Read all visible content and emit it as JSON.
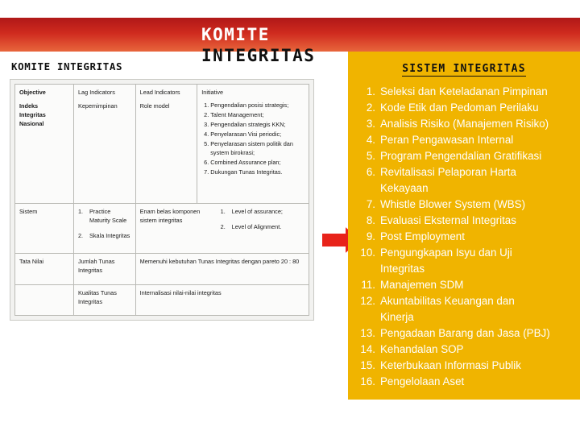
{
  "slide": {
    "left_title": "KOMITE INTEGRITAS",
    "center_title_line1": "KOMITE",
    "center_title_line2": "INTEGRITAS"
  },
  "matrix": {
    "rows": [
      {
        "c1": [
          "Objective",
          "Indeks",
          "Integritas",
          "Nasional"
        ],
        "c2": [
          "Lag Indicators",
          "Kepemimpinan"
        ],
        "c3": [
          "Lead Indicators",
          "Role model"
        ],
        "c4_header": "Initiative",
        "c4_items": [
          "Pengendalian posisi strategis;",
          "Talent Management;",
          "Pengendalian strategis KKN;",
          "Penyelarasan Visi periodic;",
          "Penyelarasan sistem politik dan system birokrasi;",
          "Combined Assurance plan;",
          "Dukungan Tunas Integritas."
        ]
      },
      {
        "c1": [
          "Sistem"
        ],
        "c2_sub": [
          {
            "num": "1.",
            "text": "Practice Maturity Scale"
          },
          {
            "num": "2.",
            "text": "Skala Integritas"
          }
        ],
        "c3_main": "Enam belas komponen sistem integritas",
        "c3_sub": [
          {
            "num": "1.",
            "text": "Level of assurance;"
          },
          {
            "num": "2.",
            "text": "Level of Alignment."
          }
        ]
      },
      {
        "c1": [
          "Tata Nilai"
        ],
        "c2": [
          "Jumlah Tunas Integritas"
        ],
        "c3": [
          "Memenuhi kebutuhan Tunas Integritas dengan pareto 20 : 80"
        ],
        "c4": [
          ""
        ]
      },
      {
        "c1": [
          ""
        ],
        "c2": [
          "Kualitas Tunas Integritas"
        ],
        "c3": [
          "Internalisasi nilai-nilai integritas"
        ],
        "c4": [
          ""
        ]
      }
    ]
  },
  "panel": {
    "title": "SISTEM INTEGRITAS",
    "items": [
      {
        "n": "1.",
        "text": "Seleksi dan Keteladanan Pimpinan"
      },
      {
        "n": "2.",
        "text": "Kode Etik dan Pedoman Perilaku"
      },
      {
        "n": "3.",
        "text": "Analisis Risiko (Manajemen Risiko)"
      },
      {
        "n": "4.",
        "text": "Peran Pengawasan Internal"
      },
      {
        "n": "5.",
        "text": "Program Pengendalian Gratifikasi"
      },
      {
        "n": "6.",
        "text": "Revitalisasi Pelaporan Harta",
        "cont": "Kekayaan"
      },
      {
        "n": "7.",
        "text": "Whistle Blower System (WBS)"
      },
      {
        "n": "8.",
        "text": "Evaluasi Eksternal Integritas"
      },
      {
        "n": "9.",
        "text": "Post Employment"
      },
      {
        "n": "10.",
        "text": "Pengungkapan Isyu dan Uji",
        "cont": "Integritas"
      },
      {
        "n": "11.",
        "text": "Manajemen SDM"
      },
      {
        "n": "12.",
        "text": "Akuntabilitas Keuangan dan",
        "cont": "Kinerja"
      },
      {
        "n": "13.",
        "text": "Pengadaan Barang dan Jasa (PBJ)"
      },
      {
        "n": "14.",
        "text": "Kehandalan SOP"
      },
      {
        "n": "15.",
        "text": "Keterbukaan Informasi Publik"
      },
      {
        "n": "16.",
        "text": "Pengelolaan Aset"
      }
    ]
  },
  "colors": {
    "banner_red": "#cf2a1e",
    "panel_yellow": "#f0b400",
    "arrow_red": "#e8231a"
  }
}
